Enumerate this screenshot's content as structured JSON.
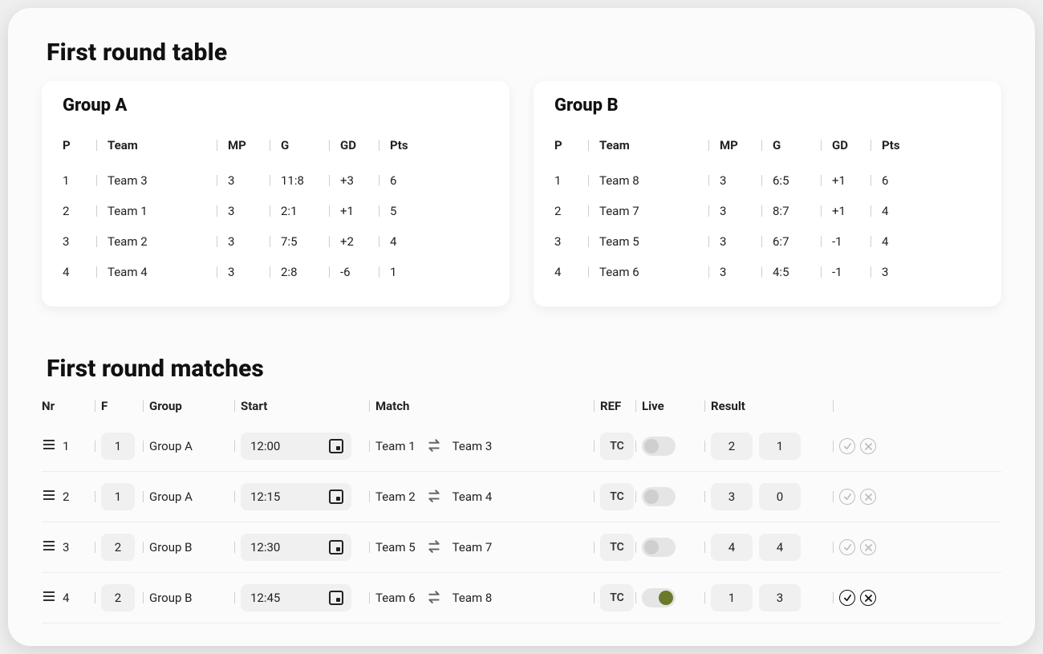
{
  "title_tables": "First round table",
  "title_matches": "First round matches",
  "group_headers": {
    "p": "P",
    "team": "Team",
    "mp": "MP",
    "g": "G",
    "gd": "GD",
    "pts": "Pts"
  },
  "groups": [
    {
      "name": "Group A",
      "rows": [
        {
          "p": "1",
          "team": "Team 3",
          "mp": "3",
          "g": "11:8",
          "gd": "+3",
          "pts": "6"
        },
        {
          "p": "2",
          "team": "Team 1",
          "mp": "3",
          "g": "2:1",
          "gd": "+1",
          "pts": "5"
        },
        {
          "p": "3",
          "team": "Team 2",
          "mp": "3",
          "g": "7:5",
          "gd": "+2",
          "pts": "4"
        },
        {
          "p": "4",
          "team": "Team 4",
          "mp": "3",
          "g": "2:8",
          "gd": "-6",
          "pts": "1"
        }
      ]
    },
    {
      "name": "Group B",
      "rows": [
        {
          "p": "1",
          "team": "Team 8",
          "mp": "3",
          "g": "6:5",
          "gd": "+1",
          "pts": "6"
        },
        {
          "p": "2",
          "team": "Team 7",
          "mp": "3",
          "g": "8:7",
          "gd": "+1",
          "pts": "4"
        },
        {
          "p": "3",
          "team": "Team 5",
          "mp": "3",
          "g": "6:7",
          "gd": "-1",
          "pts": "4"
        },
        {
          "p": "4",
          "team": "Team 6",
          "mp": "3",
          "g": "4:5",
          "gd": "-1",
          "pts": "3"
        }
      ]
    }
  ],
  "match_headers": {
    "nr": "Nr",
    "f": "F",
    "group": "Group",
    "start": "Start",
    "match": "Match",
    "ref": "REF",
    "live": "Live",
    "result": "Result"
  },
  "matches": [
    {
      "nr": "1",
      "f": "1",
      "group": "Group A",
      "start": "12:00",
      "home": "Team 1",
      "away": "Team 3",
      "ref": "TC",
      "live": false,
      "active": false,
      "score_home": "2",
      "score_away": "1"
    },
    {
      "nr": "2",
      "f": "1",
      "group": "Group A",
      "start": "12:15",
      "home": "Team 2",
      "away": "Team 4",
      "ref": "TC",
      "live": false,
      "active": false,
      "score_home": "3",
      "score_away": "0"
    },
    {
      "nr": "3",
      "f": "2",
      "group": "Group B",
      "start": "12:30",
      "home": "Team 5",
      "away": "Team 7",
      "ref": "TC",
      "live": false,
      "active": false,
      "score_home": "4",
      "score_away": "4"
    },
    {
      "nr": "4",
      "f": "2",
      "group": "Group B",
      "start": "12:45",
      "home": "Team 6",
      "away": "Team 8",
      "ref": "TC",
      "live": true,
      "active": true,
      "score_home": "1",
      "score_away": "3"
    }
  ]
}
